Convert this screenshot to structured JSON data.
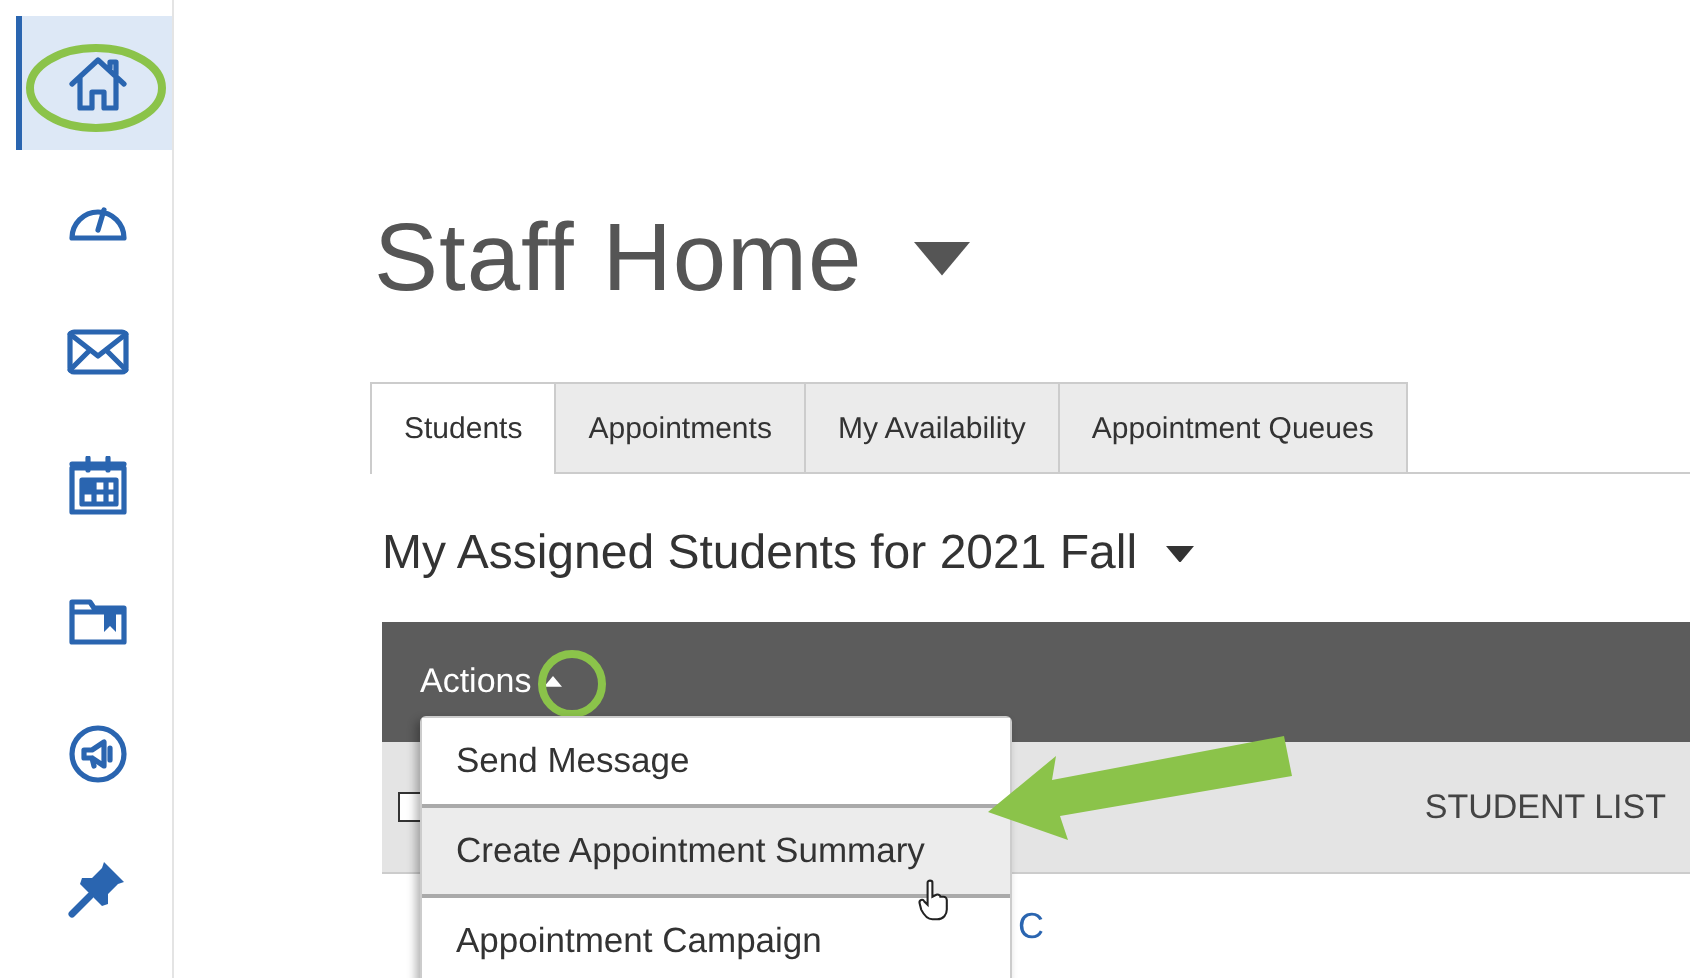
{
  "sidebar": {
    "items": [
      {
        "selected": true
      },
      {
        "selected": false
      },
      {
        "selected": false
      },
      {
        "selected": false
      },
      {
        "selected": false
      },
      {
        "selected": false
      },
      {
        "selected": false
      }
    ]
  },
  "page": {
    "title": "Staff Home"
  },
  "tabs": [
    {
      "label": "Students",
      "selected": true
    },
    {
      "label": "Appointments",
      "selected": false
    },
    {
      "label": "My Availability",
      "selected": false
    },
    {
      "label": "Appointment Queues",
      "selected": false
    }
  ],
  "section": {
    "title": "My Assigned Students for 2021 Fall"
  },
  "table": {
    "actions_label": "Actions",
    "columns": [
      {
        "kind": "checkbox",
        "checked": false
      },
      {
        "kind": "text",
        "label": "STUDENT LIST"
      }
    ],
    "rows": [
      {
        "cell": "C"
      }
    ]
  },
  "actions_menu": {
    "expanded": true,
    "items": [
      {
        "label": "Send Message",
        "selected": false
      },
      {
        "label": "Create Appointment Summary",
        "selected": true
      },
      {
        "label": "Appointment Campaign",
        "selected": false
      }
    ]
  }
}
